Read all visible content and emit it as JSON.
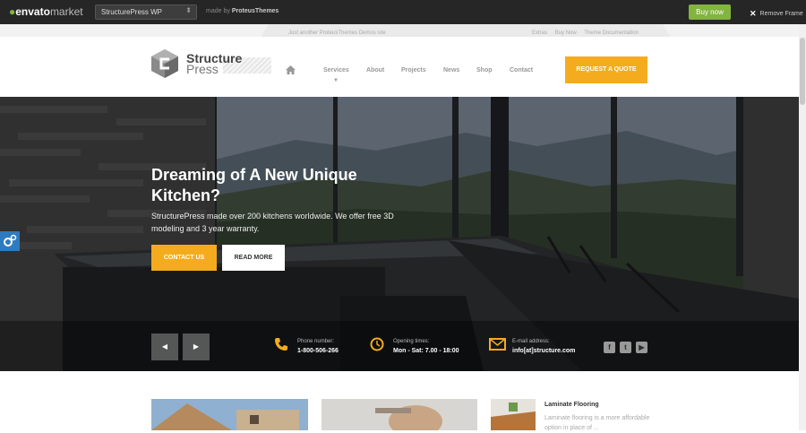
{
  "frame": {
    "brand_bold": "envato",
    "brand_light": "market",
    "theme_select": "StructurePress WP",
    "made_by_label": "made by",
    "made_by_author": "ProteusThemes",
    "buy_now": "Buy now",
    "remove_frame": "Remove Frame"
  },
  "topbar": {
    "tagline": "Just another ProteusThemes Demos site",
    "links": [
      "Extras",
      "Buy Now",
      "Theme Documentation"
    ]
  },
  "header": {
    "logo_line1": "Structure",
    "logo_line2": "Press",
    "nav": [
      "Services",
      "About",
      "Projects",
      "News",
      "Shop",
      "Contact"
    ],
    "cta": "REQUEST A QUOTE"
  },
  "hero": {
    "title": "Dreaming of A New Unique Kitchen?",
    "text": "StructurePress made over 200 kitchens worldwide. We offer free 3D modeling and 3 year warranty.",
    "btn_primary": "CONTACT US",
    "btn_secondary": "READ MORE",
    "phone_label": "Phone number:",
    "phone_value": "1-800-506-266",
    "hours_label": "Opening times:",
    "hours_value": "Mon - Sat: 7.00 - 18:00",
    "email_label": "E-mail address:",
    "email_value": "info[at]structure.com",
    "prev_arrow": "◀",
    "next_arrow": "▶"
  },
  "cards": {
    "laminate_title": "Laminate Flooring",
    "laminate_text": "Laminate flooring is a more affordable option in place of ..."
  },
  "icons": [
    "leaf-icon",
    "select-caret-icon",
    "close-icon",
    "home-icon",
    "phone-icon",
    "clock-icon",
    "mail-icon",
    "facebook-icon",
    "twitter-icon",
    "youtube-icon",
    "gear-icon"
  ],
  "colors": {
    "accent": "#f4ac1e",
    "envato_green": "#82b440",
    "frame_bar": "#262626",
    "gear_tab": "#2f7bbf"
  }
}
